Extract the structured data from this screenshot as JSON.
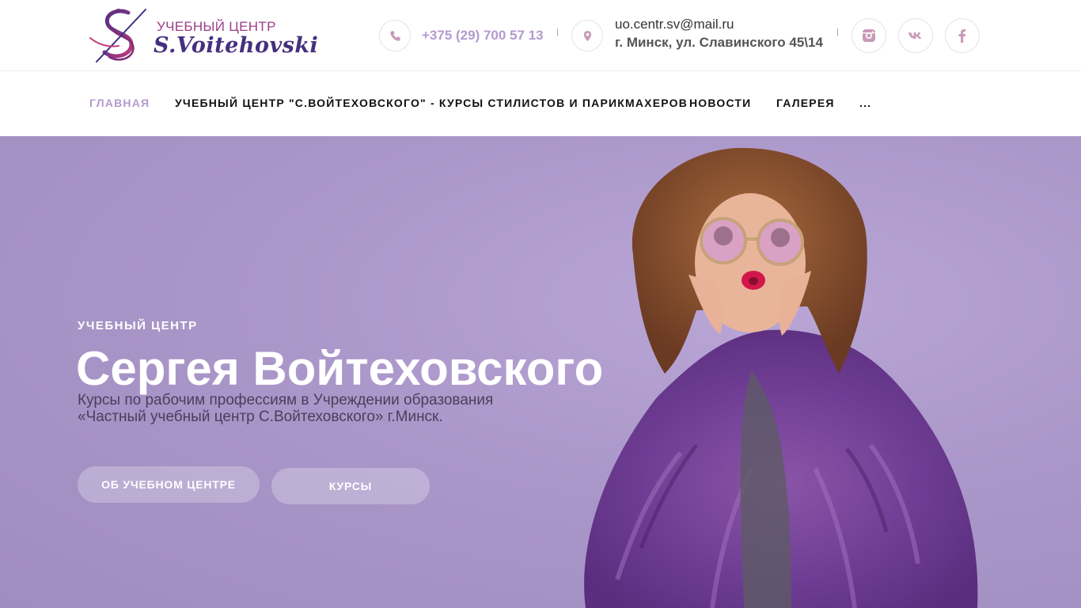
{
  "header": {
    "logo": {
      "line1": "УЧЕБНЫЙ ЦЕНТР",
      "line2": "S.Voitehovski"
    },
    "phone": "+375 (29) 700 57 13",
    "email": "uo.centr.sv@mail.ru",
    "address": "г. Минск, ул. Славинского 45\\14",
    "social": [
      "instagram-icon",
      "vk-icon",
      "facebook-icon"
    ]
  },
  "nav": {
    "home": "ГЛАВНАЯ",
    "center": "УЧЕБНЫЙ ЦЕНТР \"С.ВОЙТЕХОВСКОГО\" - КУРСЫ СТИЛИСТОВ И ПАРИКМАХЕРОВ",
    "news": "НОВОСТИ",
    "gallery": "ГАЛЕРЕЯ",
    "more": "..."
  },
  "hero": {
    "eyebrow": "УЧЕБНЫЙ ЦЕНТР",
    "title": "Сергея Войтеховского",
    "desc_line1": "Курсы по рабочим профессиям в Учреждении образования",
    "desc_line2": "«Частный учебный центр С.Войтеховского» г.Минск.",
    "btn_about": "ОБ УЧЕБНОМ ЦЕНТРЕ",
    "btn_courses": "КУРСЫ"
  },
  "colors": {
    "accent": "#b49ad0",
    "brand_purple": "#45307f",
    "brand_magenta": "#9b3e8a",
    "hero_bg": "#ac9acb"
  }
}
